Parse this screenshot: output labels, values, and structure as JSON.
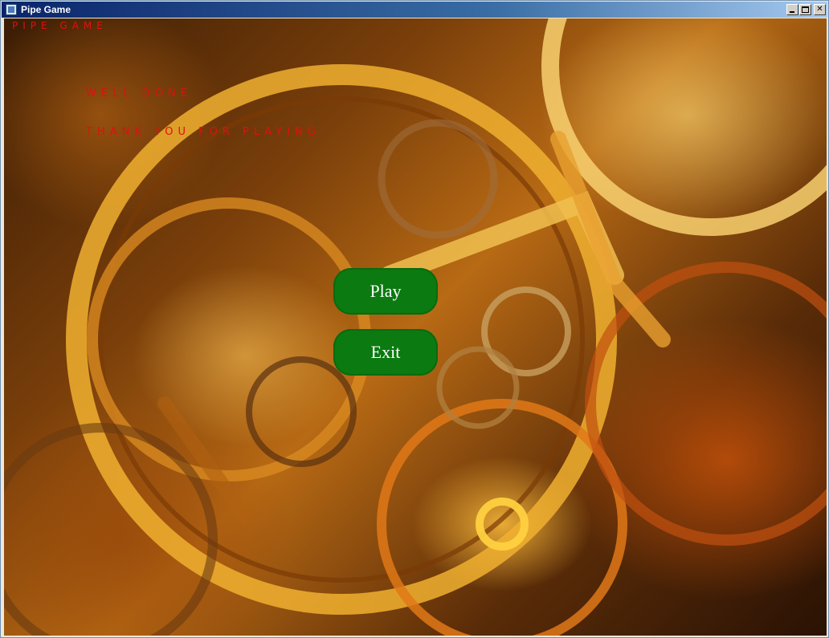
{
  "window": {
    "title": "Pipe Game",
    "controls": [
      "minimize",
      "maximize",
      "close"
    ],
    "close_glyph": "✕"
  },
  "game": {
    "header": "Pipe Game",
    "messages": {
      "line1": "Well Done",
      "line2": "Thank You For Playing"
    },
    "buttons": {
      "play": "Play",
      "exit": "Exit"
    },
    "colors": {
      "text_red": "#e01010",
      "button_green": "#0b7a10"
    },
    "background": "clockwork gears"
  }
}
